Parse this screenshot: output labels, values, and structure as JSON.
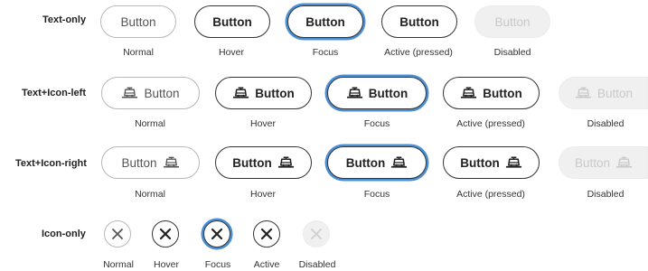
{
  "rows": {
    "text_only": {
      "label": "Text-only",
      "buttons": {
        "normal": "Button",
        "hover": "Button",
        "focus": "Button",
        "active": "Button",
        "disabled": "Button"
      }
    },
    "icon_left": {
      "label": "Text+Icon-left",
      "icon": "tram-icon",
      "buttons": {
        "normal": "Button",
        "hover": "Button",
        "focus": "Button",
        "active": "Button",
        "disabled": "Button"
      }
    },
    "icon_right": {
      "label": "Text+Icon-right",
      "icon": "tram-icon",
      "buttons": {
        "normal": "Button",
        "hover": "Button",
        "focus": "Button",
        "active": "Button",
        "disabled": "Button"
      }
    },
    "icon_only": {
      "label": "Icon-only",
      "icon": "close-icon"
    }
  },
  "states": {
    "normal": "Normal",
    "hover": "Hover",
    "focus": "Focus",
    "active": "Active (pressed)",
    "active_short": "Active",
    "disabled": "Disabled"
  },
  "colors": {
    "focus_ring": "#4a8fd4",
    "dark_border": "#333333",
    "light_border": "#b8b8b8",
    "disabled_bg": "#f0f0f0",
    "disabled_text": "#c9c9c9"
  }
}
